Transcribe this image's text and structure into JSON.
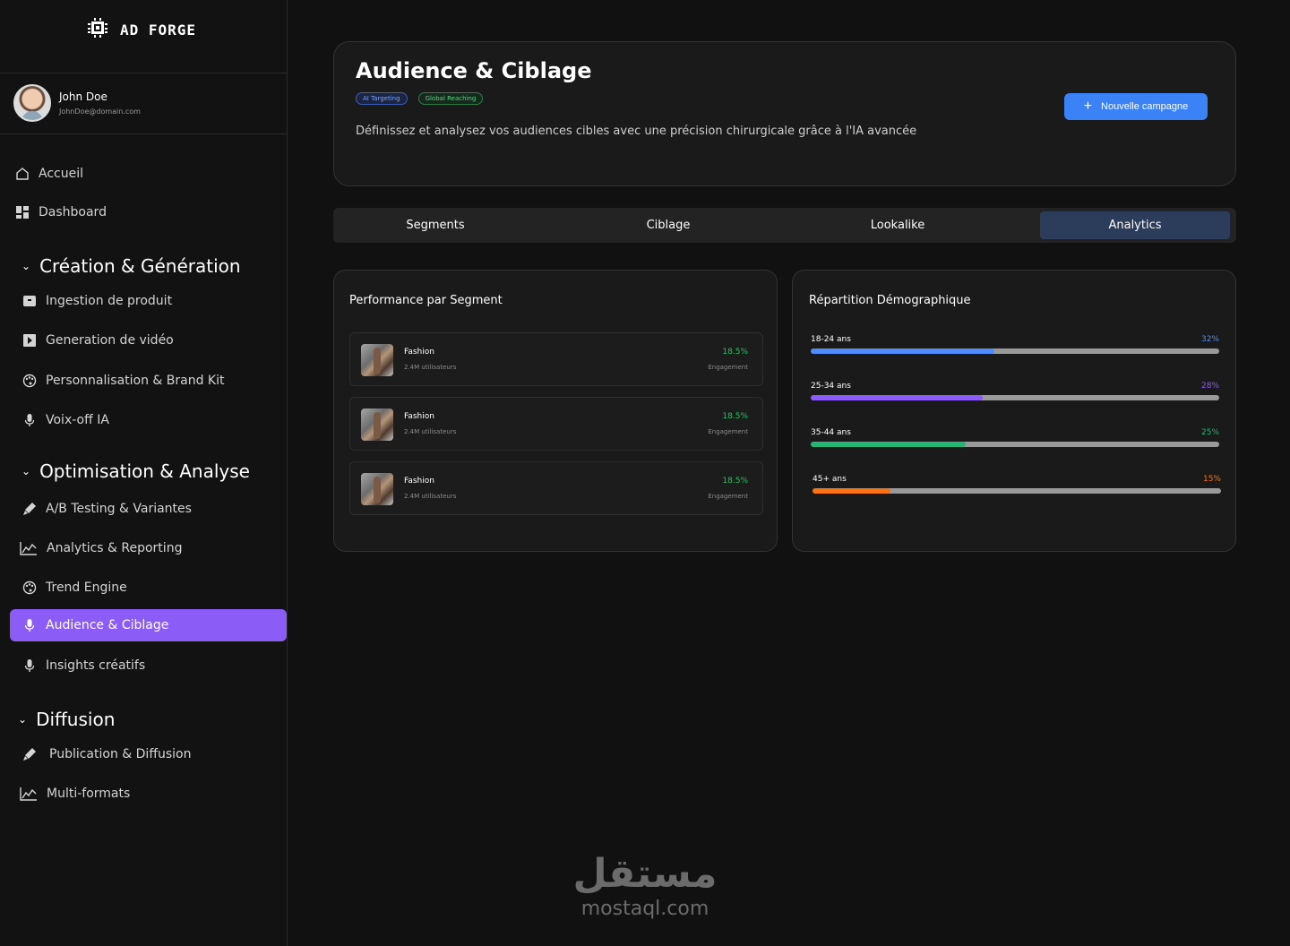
{
  "app": {
    "logo_text": "AD FORGE",
    "user_name": "John Doe",
    "user_email": "JohnDoe@domain.com"
  },
  "sidebar": {
    "top_items": [
      {
        "label": "Accueil",
        "icon": "home-icon"
      },
      {
        "label": "Dashboard",
        "icon": "dashboard-icon"
      }
    ],
    "sections": [
      {
        "title": "Création & Génération",
        "items": [
          {
            "label": "Ingestion de produit",
            "icon": "box-icon"
          },
          {
            "label": "Generation de vidéo",
            "icon": "video-icon"
          },
          {
            "label": "Personnalisation & Brand Kit",
            "icon": "palette-icon"
          },
          {
            "label": "Voix-off IA",
            "icon": "mic-icon"
          }
        ]
      },
      {
        "title": "Optimisation & Analyse",
        "items": [
          {
            "label": "A/B Testing & Variantes",
            "icon": "brush-icon"
          },
          {
            "label": "Analytics & Reporting",
            "icon": "chart-line-icon"
          },
          {
            "label": "Trend Engine",
            "icon": "palette-icon"
          },
          {
            "label": "Audience & Ciblage",
            "icon": "mic-icon",
            "active": true
          },
          {
            "label": "Insights créatifs",
            "icon": "mic-icon"
          }
        ]
      },
      {
        "title": "Diffusion",
        "items": [
          {
            "label": "Publication & Diffusion",
            "icon": "brush-icon"
          },
          {
            "label": "Multi-formats",
            "icon": "chart-line-icon"
          }
        ]
      }
    ]
  },
  "header": {
    "title": "Audience & Ciblage",
    "badges": [
      "AI Targeting",
      "Global Reaching"
    ],
    "description": "Définissez et analysez vos audiences cibles avec une précision chirurgicale grâce à l'IA avancée",
    "new_campaign_label": "Nouvelle campagne"
  },
  "tabs": [
    {
      "label": "Segments"
    },
    {
      "label": "Ciblage"
    },
    {
      "label": "Lookalike"
    },
    {
      "label": "Analytics",
      "active": true
    }
  ],
  "performance": {
    "title": "Performance par Segment",
    "segments": [
      {
        "name": "Fashion",
        "users": "2.4M utilisateurs",
        "rate": "18.5%",
        "metric": "Engagement"
      },
      {
        "name": "Fashion",
        "users": "2.4M utilisateurs",
        "rate": "18.5%",
        "metric": "Engagement"
      },
      {
        "name": "Fashion",
        "users": "2.4M utilisateurs",
        "rate": "18.5%",
        "metric": "Engagement"
      }
    ]
  },
  "demographics": {
    "title": "Répartition Démographique",
    "groups": [
      {
        "label": "18-24 ans",
        "pct": "32%",
        "value": 0.45,
        "color": "#4c8dfb"
      },
      {
        "label": "25-34 ans",
        "pct": "28%",
        "value": 0.42,
        "color": "#8b5cf6"
      },
      {
        "label": "35-44 ans",
        "pct": "25%",
        "value": 0.38,
        "color": "#22b573"
      },
      {
        "label": "45+ ans",
        "pct": "15%",
        "value": 0.19,
        "color": "#f97316"
      }
    ]
  },
  "colors": {
    "accent_purple": "#8b5cf6",
    "accent_blue": "#3b82f6",
    "positive_green": "#22c55e"
  },
  "watermark": {
    "arabic": "مستقل",
    "latin": "mostaql.com"
  }
}
